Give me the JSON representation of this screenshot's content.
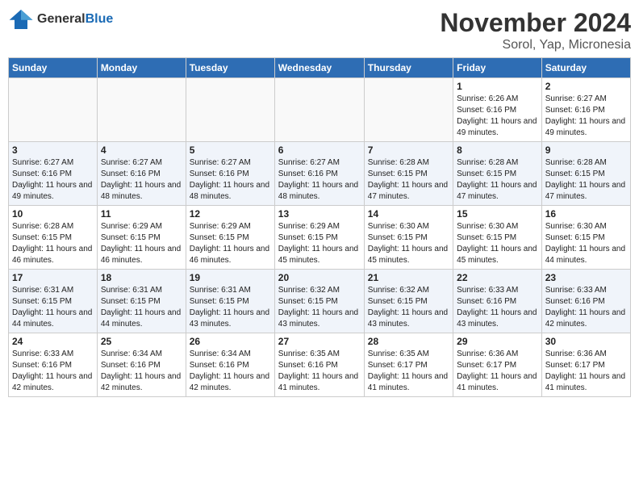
{
  "logo": {
    "general": "General",
    "blue": "Blue"
  },
  "title": "November 2024",
  "subtitle": "Sorol, Yap, Micronesia",
  "days_header": [
    "Sunday",
    "Monday",
    "Tuesday",
    "Wednesday",
    "Thursday",
    "Friday",
    "Saturday"
  ],
  "weeks": [
    [
      {
        "day": "",
        "info": ""
      },
      {
        "day": "",
        "info": ""
      },
      {
        "day": "",
        "info": ""
      },
      {
        "day": "",
        "info": ""
      },
      {
        "day": "",
        "info": ""
      },
      {
        "day": "1",
        "info": "Sunrise: 6:26 AM\nSunset: 6:16 PM\nDaylight: 11 hours and 49 minutes."
      },
      {
        "day": "2",
        "info": "Sunrise: 6:27 AM\nSunset: 6:16 PM\nDaylight: 11 hours and 49 minutes."
      }
    ],
    [
      {
        "day": "3",
        "info": "Sunrise: 6:27 AM\nSunset: 6:16 PM\nDaylight: 11 hours and 49 minutes."
      },
      {
        "day": "4",
        "info": "Sunrise: 6:27 AM\nSunset: 6:16 PM\nDaylight: 11 hours and 48 minutes."
      },
      {
        "day": "5",
        "info": "Sunrise: 6:27 AM\nSunset: 6:16 PM\nDaylight: 11 hours and 48 minutes."
      },
      {
        "day": "6",
        "info": "Sunrise: 6:27 AM\nSunset: 6:16 PM\nDaylight: 11 hours and 48 minutes."
      },
      {
        "day": "7",
        "info": "Sunrise: 6:28 AM\nSunset: 6:15 PM\nDaylight: 11 hours and 47 minutes."
      },
      {
        "day": "8",
        "info": "Sunrise: 6:28 AM\nSunset: 6:15 PM\nDaylight: 11 hours and 47 minutes."
      },
      {
        "day": "9",
        "info": "Sunrise: 6:28 AM\nSunset: 6:15 PM\nDaylight: 11 hours and 47 minutes."
      }
    ],
    [
      {
        "day": "10",
        "info": "Sunrise: 6:28 AM\nSunset: 6:15 PM\nDaylight: 11 hours and 46 minutes."
      },
      {
        "day": "11",
        "info": "Sunrise: 6:29 AM\nSunset: 6:15 PM\nDaylight: 11 hours and 46 minutes."
      },
      {
        "day": "12",
        "info": "Sunrise: 6:29 AM\nSunset: 6:15 PM\nDaylight: 11 hours and 46 minutes."
      },
      {
        "day": "13",
        "info": "Sunrise: 6:29 AM\nSunset: 6:15 PM\nDaylight: 11 hours and 45 minutes."
      },
      {
        "day": "14",
        "info": "Sunrise: 6:30 AM\nSunset: 6:15 PM\nDaylight: 11 hours and 45 minutes."
      },
      {
        "day": "15",
        "info": "Sunrise: 6:30 AM\nSunset: 6:15 PM\nDaylight: 11 hours and 45 minutes."
      },
      {
        "day": "16",
        "info": "Sunrise: 6:30 AM\nSunset: 6:15 PM\nDaylight: 11 hours and 44 minutes."
      }
    ],
    [
      {
        "day": "17",
        "info": "Sunrise: 6:31 AM\nSunset: 6:15 PM\nDaylight: 11 hours and 44 minutes."
      },
      {
        "day": "18",
        "info": "Sunrise: 6:31 AM\nSunset: 6:15 PM\nDaylight: 11 hours and 44 minutes."
      },
      {
        "day": "19",
        "info": "Sunrise: 6:31 AM\nSunset: 6:15 PM\nDaylight: 11 hours and 43 minutes."
      },
      {
        "day": "20",
        "info": "Sunrise: 6:32 AM\nSunset: 6:15 PM\nDaylight: 11 hours and 43 minutes."
      },
      {
        "day": "21",
        "info": "Sunrise: 6:32 AM\nSunset: 6:15 PM\nDaylight: 11 hours and 43 minutes."
      },
      {
        "day": "22",
        "info": "Sunrise: 6:33 AM\nSunset: 6:16 PM\nDaylight: 11 hours and 43 minutes."
      },
      {
        "day": "23",
        "info": "Sunrise: 6:33 AM\nSunset: 6:16 PM\nDaylight: 11 hours and 42 minutes."
      }
    ],
    [
      {
        "day": "24",
        "info": "Sunrise: 6:33 AM\nSunset: 6:16 PM\nDaylight: 11 hours and 42 minutes."
      },
      {
        "day": "25",
        "info": "Sunrise: 6:34 AM\nSunset: 6:16 PM\nDaylight: 11 hours and 42 minutes."
      },
      {
        "day": "26",
        "info": "Sunrise: 6:34 AM\nSunset: 6:16 PM\nDaylight: 11 hours and 42 minutes."
      },
      {
        "day": "27",
        "info": "Sunrise: 6:35 AM\nSunset: 6:16 PM\nDaylight: 11 hours and 41 minutes."
      },
      {
        "day": "28",
        "info": "Sunrise: 6:35 AM\nSunset: 6:17 PM\nDaylight: 11 hours and 41 minutes."
      },
      {
        "day": "29",
        "info": "Sunrise: 6:36 AM\nSunset: 6:17 PM\nDaylight: 11 hours and 41 minutes."
      },
      {
        "day": "30",
        "info": "Sunrise: 6:36 AM\nSunset: 6:17 PM\nDaylight: 11 hours and 41 minutes."
      }
    ]
  ]
}
